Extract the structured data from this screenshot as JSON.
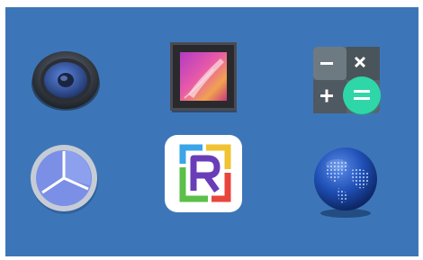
{
  "launcher": {
    "apps": [
      {
        "id": "music",
        "label": "",
        "icon": "speaker-icon"
      },
      {
        "id": "gallery",
        "label": "",
        "icon": "gallery-photo-icon"
      },
      {
        "id": "calculator",
        "label": "",
        "icon": "calculator-icon"
      },
      {
        "id": "clock",
        "label": "",
        "icon": "clock-icon"
      },
      {
        "id": "r-app",
        "label": "",
        "icon": "r-logo-icon"
      },
      {
        "id": "browser",
        "label": "",
        "icon": "globe-icon"
      }
    ]
  },
  "colors": {
    "background": "#3d76b8",
    "calculator_accent": "#2fd6a8",
    "clock_face": "#7b8fe6",
    "globe": "#1f4fb5"
  }
}
